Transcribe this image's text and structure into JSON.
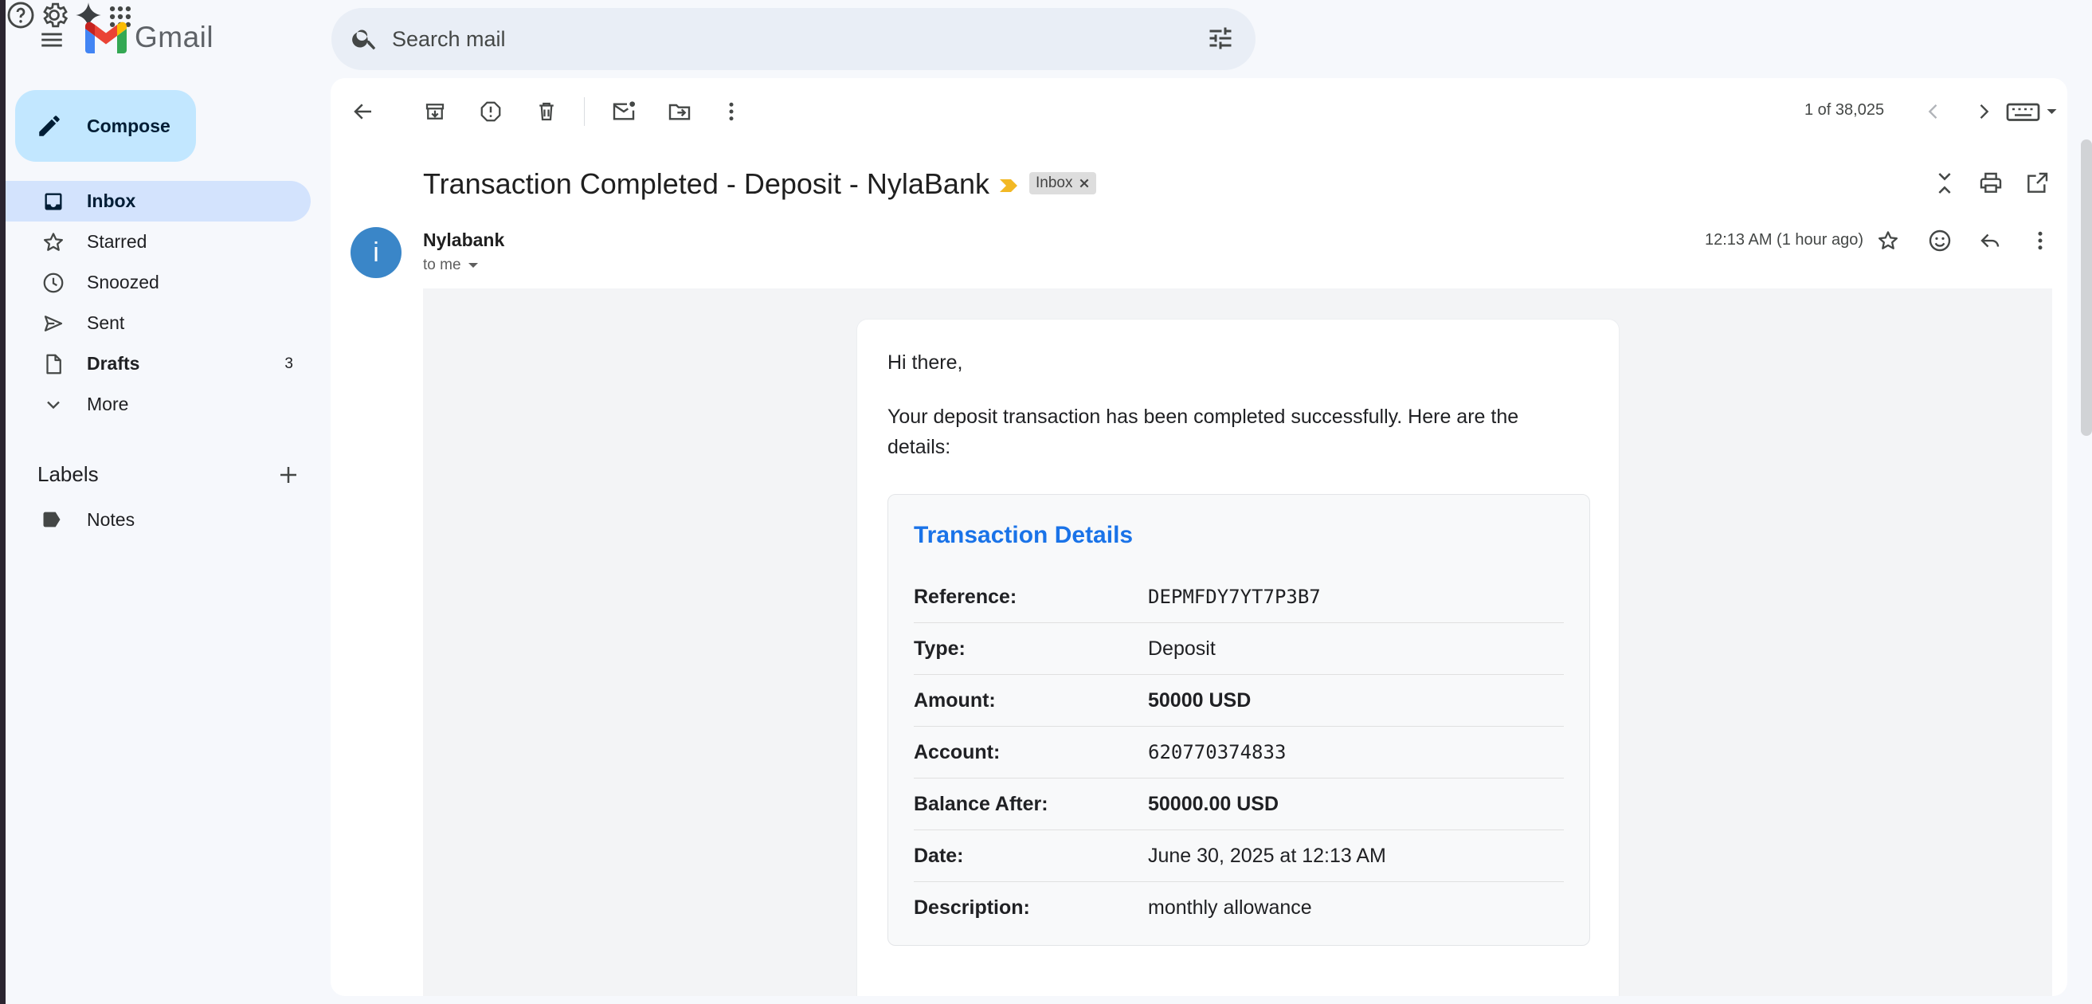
{
  "app": {
    "name": "Gmail",
    "brand_colors": {
      "red": "#ea4335",
      "blue": "#4285f4",
      "green": "#34a853",
      "yellow": "#fbbc04"
    }
  },
  "search": {
    "placeholder": "Search mail"
  },
  "compose": {
    "label": "Compose"
  },
  "nav": {
    "items": [
      {
        "label": "Inbox",
        "icon": "inbox-icon",
        "active": true
      },
      {
        "label": "Starred",
        "icon": "star-icon"
      },
      {
        "label": "Snoozed",
        "icon": "clock-icon"
      },
      {
        "label": "Sent",
        "icon": "send-icon"
      },
      {
        "label": "Drafts",
        "icon": "draft-icon",
        "count": "3"
      },
      {
        "label": "More",
        "icon": "chevron-down-icon"
      }
    ]
  },
  "labels": {
    "title": "Labels",
    "items": [
      {
        "label": "Notes",
        "icon": "label-icon"
      }
    ]
  },
  "toolbar": {
    "pager": "1 of 38,025"
  },
  "message": {
    "subject": "Transaction Completed - Deposit - NylaBank",
    "label_chip": "Inbox",
    "sender": "Nylabank",
    "avatar_letter": "i",
    "to": "to me",
    "time": "12:13 AM (1 hour ago)",
    "body": {
      "greeting": "Hi there,",
      "intro": "Your deposit transaction has been completed successfully. Here are the details:",
      "details_title": "Transaction Details",
      "rows": [
        {
          "key": "Reference:",
          "value": "DEPMFDY7YT7P3B7"
        },
        {
          "key": "Type:",
          "value": "Deposit"
        },
        {
          "key": "Amount:",
          "value": "50000 USD"
        },
        {
          "key": "Account:",
          "value": "620770374833"
        },
        {
          "key": "Balance After:",
          "value": "50000.00 USD"
        },
        {
          "key": "Date:",
          "value": "June 30, 2025 at 12:13 AM"
        },
        {
          "key": "Description:",
          "value": "monthly allowance"
        }
      ]
    }
  }
}
